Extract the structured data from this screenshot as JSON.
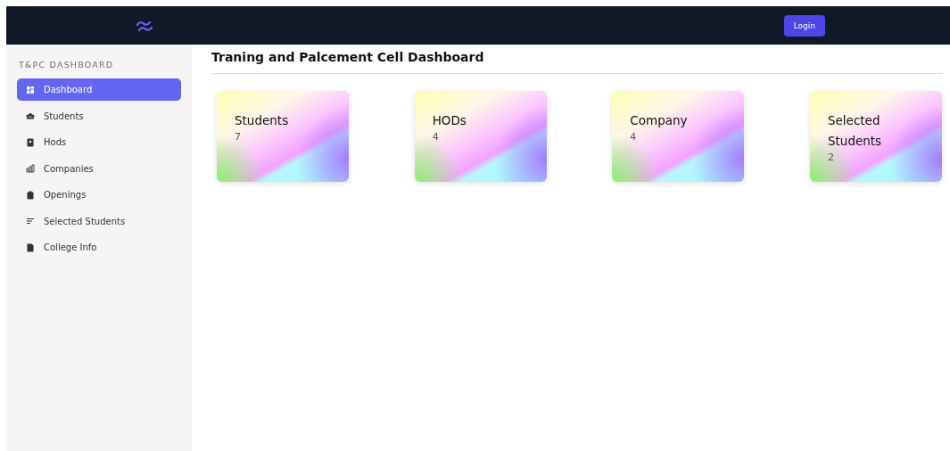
{
  "navbar": {
    "login_button": "Login"
  },
  "sidebar": {
    "heading": "T&PC DASHBOARD",
    "items": [
      {
        "label": "Dashboard",
        "selected": true
      },
      {
        "label": "Students",
        "selected": false
      },
      {
        "label": "Hods",
        "selected": false
      },
      {
        "label": "Companies",
        "selected": false
      },
      {
        "label": "Openings",
        "selected": false
      },
      {
        "label": "Selected Students",
        "selected": false
      },
      {
        "label": "College Info",
        "selected": false
      }
    ]
  },
  "main": {
    "title": "Traning and Palcement Cell Dashboard",
    "cards": [
      {
        "title": "Students",
        "count": "7"
      },
      {
        "title": "HODs",
        "count": "4"
      },
      {
        "title": "Company",
        "count": "4"
      },
      {
        "title": "Selected Students",
        "count": "2"
      }
    ]
  }
}
